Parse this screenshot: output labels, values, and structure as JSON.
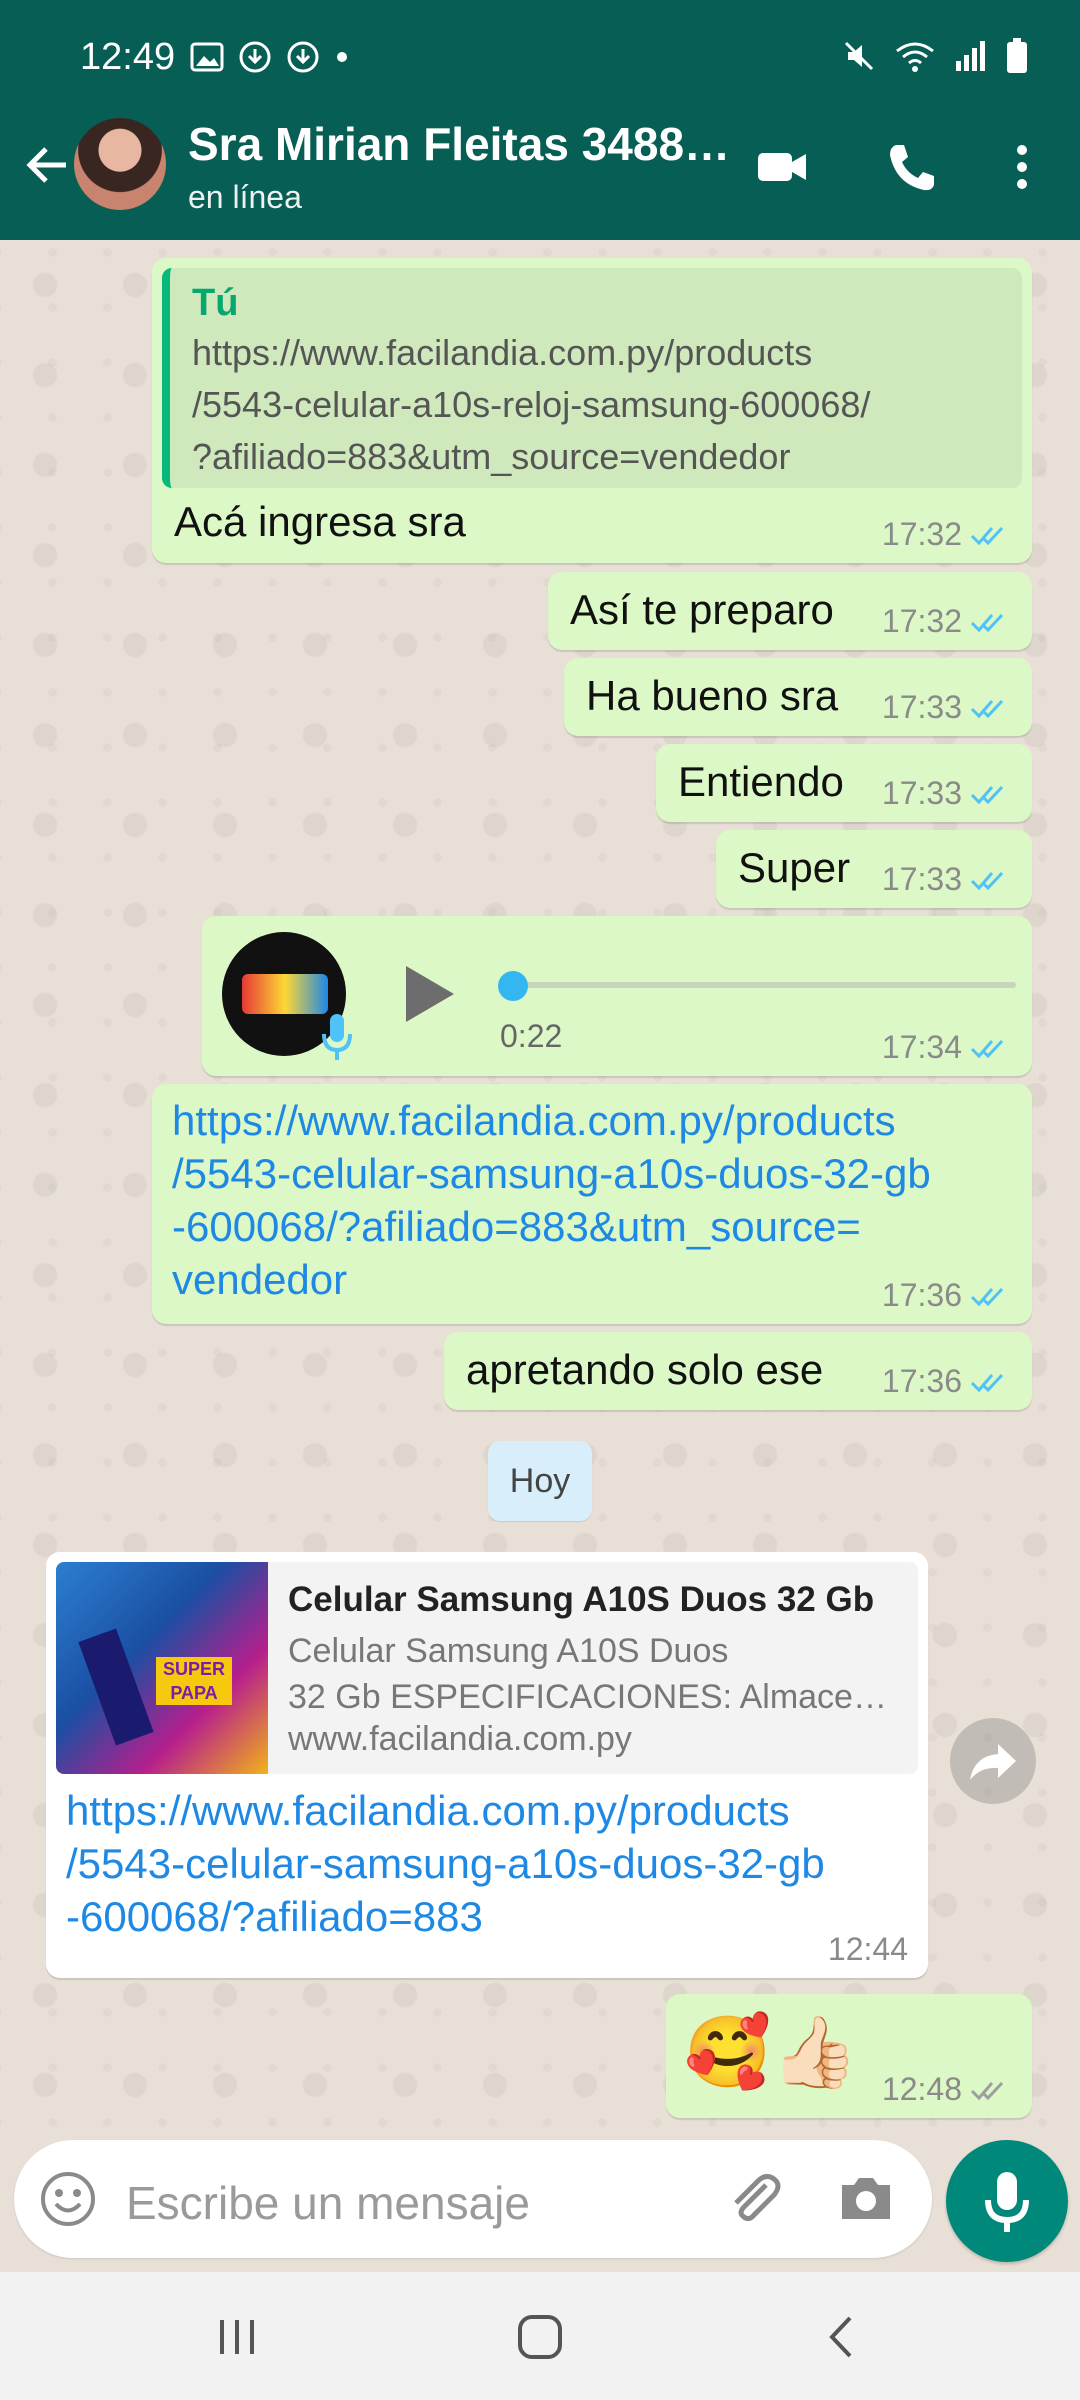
{
  "status_bar": {
    "time": "12:49"
  },
  "header": {
    "contact_name": "Sra Mirian Fleitas 3488…",
    "status": "en línea"
  },
  "messages": [
    {
      "quote_author": "Tú",
      "quote_lines": [
        "https://www.facilandia.com.py/products",
        "/5543-celular-a10s-reloj-samsung-600068/",
        "?afiliado=883&utm_source=vendedor"
      ],
      "text": "Acá ingresa sra",
      "time": "17:32"
    },
    {
      "text": "Así te preparo",
      "time": "17:32"
    },
    {
      "text": "Ha bueno sra",
      "time": "17:33"
    },
    {
      "text": "Entiendo",
      "time": "17:33"
    },
    {
      "text": "Super",
      "time": "17:33"
    },
    {
      "duration": "0:22",
      "time": "17:34",
      "progress": 0
    },
    {
      "link_lines": [
        "https://www.facilandia.com.py/products",
        "/5543-celular-samsung-a10s-duos-32-gb",
        "-600068/?afiliado=883&utm_source=",
        "vendedor"
      ],
      "time": "17:36"
    },
    {
      "text": "apretando solo ese",
      "time": "17:36"
    },
    {
      "preview_title": "Celular Samsung A10S Duos 32 Gb",
      "preview_desc_lines": [
        "Celular Samsung A10S Duos",
        "32 Gb ESPECIFICACIONES: Almace…"
      ],
      "preview_domain": "www.facilandia.com.py",
      "link_lines": [
        "https://www.facilandia.com.py/products",
        "/5543-celular-samsung-a10s-duos-32-gb",
        "-600068/?afiliado=883"
      ],
      "time": "12:44"
    },
    {
      "text": "🥰👍🏻",
      "time": "12:48"
    }
  ],
  "day_divider": "Hoy",
  "composer": {
    "placeholder": "Escribe un mensaje"
  },
  "colors": {
    "header": "#075e54",
    "outgoing": "#dcf8c6",
    "incoming": "#ffffff",
    "link": "#1e88e5",
    "read_ticks": "#4fc3f7",
    "fab": "#00897b"
  },
  "icons": [
    "image-icon",
    "download-icon",
    "wifi-icon",
    "signal-icon",
    "battery-icon",
    "mute-icon",
    "back-arrow-icon",
    "video-call-icon",
    "phone-icon",
    "more-icon",
    "play-icon",
    "mic-icon",
    "emoji-icon",
    "attach-icon",
    "camera-icon",
    "share-icon",
    "recents-icon",
    "home-icon",
    "back-nav-icon"
  ]
}
